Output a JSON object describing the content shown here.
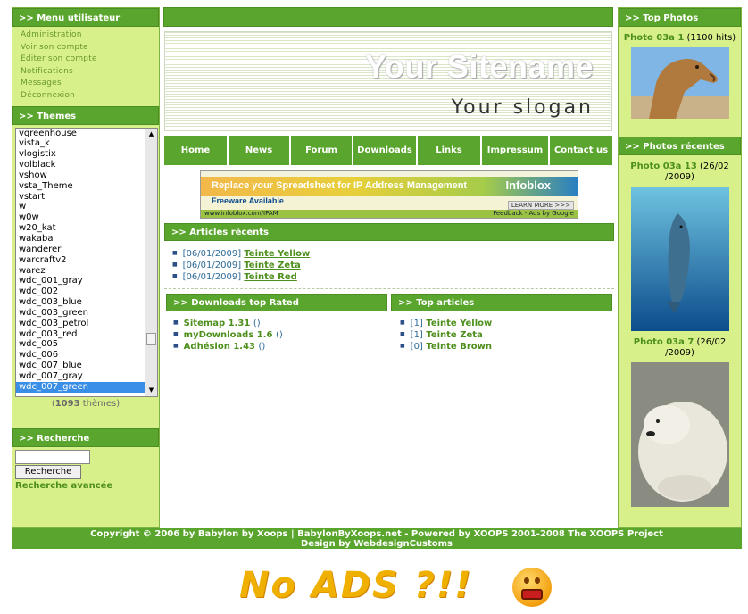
{
  "colors": {
    "green": "#5aa52d",
    "light_green": "#d8f08a",
    "link_green": "#4d8f1c",
    "blue_text": "#2d6a96",
    "select_blue": "#3a8ee6"
  },
  "user_menu": {
    "title": ">> Menu utilisateur",
    "items": [
      "Administration",
      "Voir son compte",
      "Editer son compte",
      "Notifications",
      "Messages",
      "Déconnexion"
    ]
  },
  "themes": {
    "title": ">> Themes",
    "items": [
      "vgreenhouse",
      "vista_k",
      "vlogistix",
      "volblack",
      "vshow",
      "vsta_Theme",
      "vstart",
      "w",
      "w0w",
      "w20_kat",
      "wakaba",
      "wanderer",
      "warcraftv2",
      "warez",
      "wdc_001_gray",
      "wdc_002",
      "wdc_003_blue",
      "wdc_003_green",
      "wdc_003_petrol",
      "wdc_003_red",
      "wdc_005",
      "wdc_006",
      "wdc_007_blue",
      "wdc_007_gray",
      "wdc_007_green"
    ],
    "selected": "wdc_007_green",
    "count_open": "(",
    "count": "1093",
    "count_suffix": " thèmes)"
  },
  "search": {
    "title": ">> Recherche",
    "input_value": "",
    "button_label": "Recherche",
    "advanced_label": "Recherche avancée"
  },
  "header": {
    "site_name": "Your Sitename",
    "slogan": "Your slogan"
  },
  "nav": [
    "Home",
    "News",
    "Forum",
    "Downloads",
    "Links",
    "Impressum",
    "Contact us"
  ],
  "ad": {
    "headline": "Replace your Spreadsheet for IP Address Management",
    "subline": "Freeware Available",
    "brand": "Infoblox",
    "button": "LEARN MORE >>>",
    "url": "www.infoblox.com/IPAM",
    "feedback": "Feedback - Ads by Google"
  },
  "recent_articles": {
    "title": ">> Articles récents",
    "items": [
      {
        "date": "[06/01/2009]",
        "title": "Teinte Yellow"
      },
      {
        "date": "[06/01/2009]",
        "title": "Teinte Zeta"
      },
      {
        "date": "[06/01/2009]",
        "title": "Teinte Red"
      }
    ]
  },
  "downloads_top": {
    "title": ">> Downloads top Rated",
    "items": [
      {
        "name": "Sitemap 1.31",
        "rating": "()"
      },
      {
        "name": "myDownloads 1.6",
        "rating": "()"
      },
      {
        "name": "Adhésion 1.43",
        "rating": "()"
      }
    ]
  },
  "top_articles": {
    "title": ">> Top articles",
    "items": [
      {
        "count": "[1]",
        "title": "Teinte Yellow"
      },
      {
        "count": "[1]",
        "title": "Teinte Zeta"
      },
      {
        "count": "[0]",
        "title": "Teinte Brown"
      }
    ]
  },
  "top_photos": {
    "title": ">> Top Photos",
    "photo_name": "Photo 03a 1",
    "photo_info": " (1100 hits)"
  },
  "recent_photos": {
    "title": ">> Photos récentes",
    "items": [
      {
        "name": "Photo 03a 13",
        "info": " (26/02 /2009)"
      },
      {
        "name": "Photo 03a 7",
        "info": " (26/02 /2009)"
      }
    ]
  },
  "footer": {
    "line1": "Copyright © 2006 by Babylon by Xoops  |  BabylonByXoops.net - Powered by XOOPS 2001-2008 The XOOPS Project",
    "line2": "Design by WebdesignCustoms"
  },
  "below": {
    "text": "No ADS ?!!"
  }
}
